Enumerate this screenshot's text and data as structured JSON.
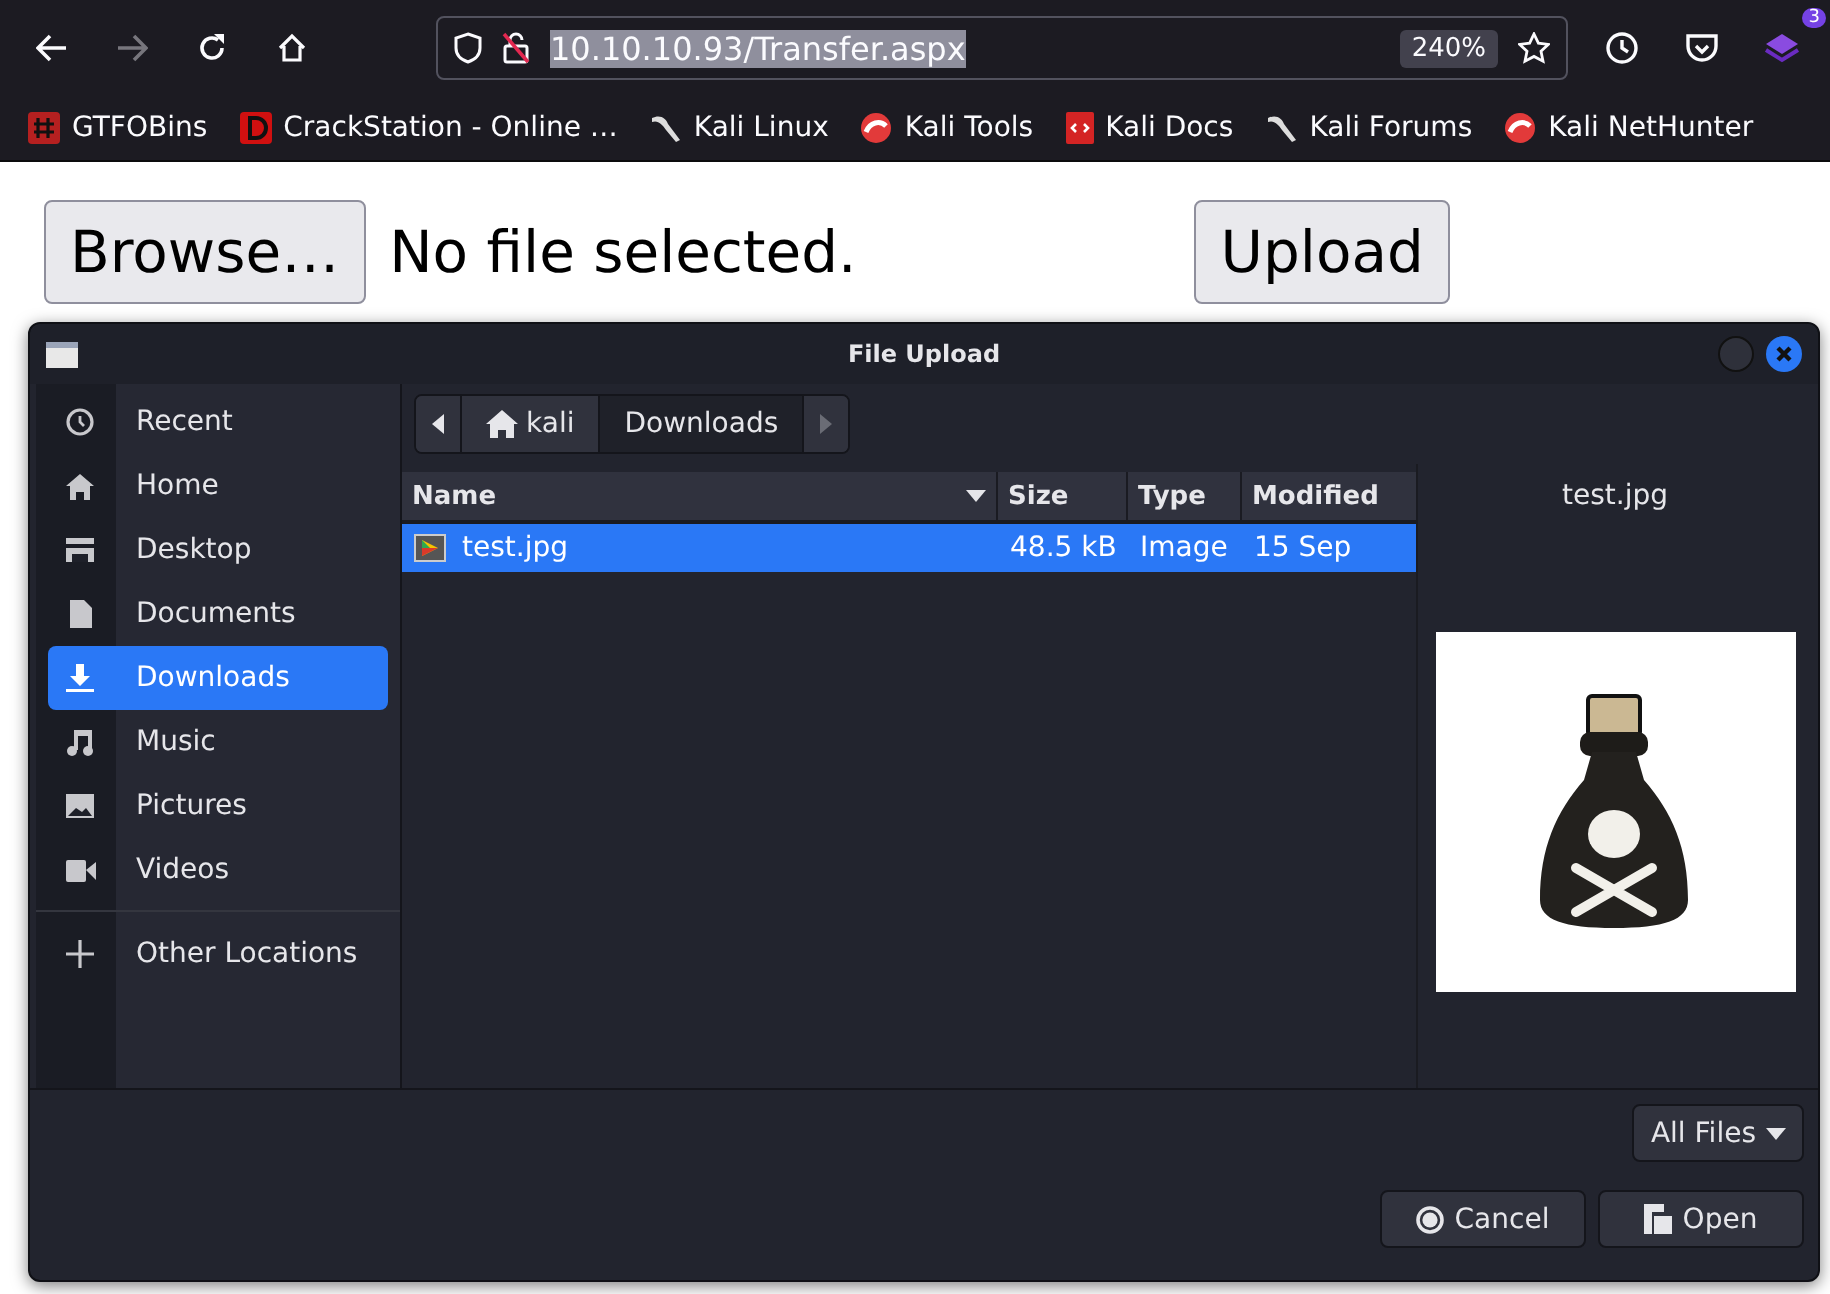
{
  "browser": {
    "url": "10.10.10.93/Transfer.aspx",
    "zoom": "240%",
    "extension_badge": "3",
    "bookmarks": [
      {
        "label": "GTFOBins"
      },
      {
        "label": "CrackStation - Online …"
      },
      {
        "label": "Kali Linux"
      },
      {
        "label": "Kali Tools"
      },
      {
        "label": "Kali Docs"
      },
      {
        "label": "Kali Forums"
      },
      {
        "label": "Kali NetHunter"
      }
    ]
  },
  "page": {
    "browse_button": "Browse…",
    "file_status": "No file selected.",
    "upload_button": "Upload"
  },
  "dialog": {
    "title": "File Upload",
    "places": [
      {
        "label": "Recent",
        "kind": "place",
        "selected": false
      },
      {
        "label": "Home",
        "kind": "place",
        "selected": false
      },
      {
        "label": "Desktop",
        "kind": "place",
        "selected": false
      },
      {
        "label": "Documents",
        "kind": "place",
        "selected": false
      },
      {
        "label": "Downloads",
        "kind": "place",
        "selected": true
      },
      {
        "label": "Music",
        "kind": "place",
        "selected": false
      },
      {
        "label": "Pictures",
        "kind": "place",
        "selected": false
      },
      {
        "label": "Videos",
        "kind": "place",
        "selected": false
      },
      {
        "label": "Other Locations",
        "kind": "other",
        "selected": false
      }
    ],
    "path": [
      {
        "label": "kali",
        "kind": "home",
        "selected": false
      },
      {
        "label": "Downloads",
        "kind": "folder",
        "selected": true
      }
    ],
    "columns": [
      {
        "label": "Name",
        "sorted": true
      },
      {
        "label": "Size",
        "sorted": false
      },
      {
        "label": "Type",
        "sorted": false
      },
      {
        "label": "Modified",
        "sorted": false
      }
    ],
    "files": [
      {
        "name": "test.jpg",
        "size": "48.5 kB",
        "type": "Image",
        "modified": "15 Sep",
        "selected": true
      }
    ],
    "preview": {
      "filename": "test.jpg",
      "kind": "picture"
    },
    "filter": "All Files",
    "buttons": [
      {
        "label": "Cancel",
        "kind": "cancel"
      },
      {
        "label": "Open",
        "kind": "open"
      }
    ]
  }
}
